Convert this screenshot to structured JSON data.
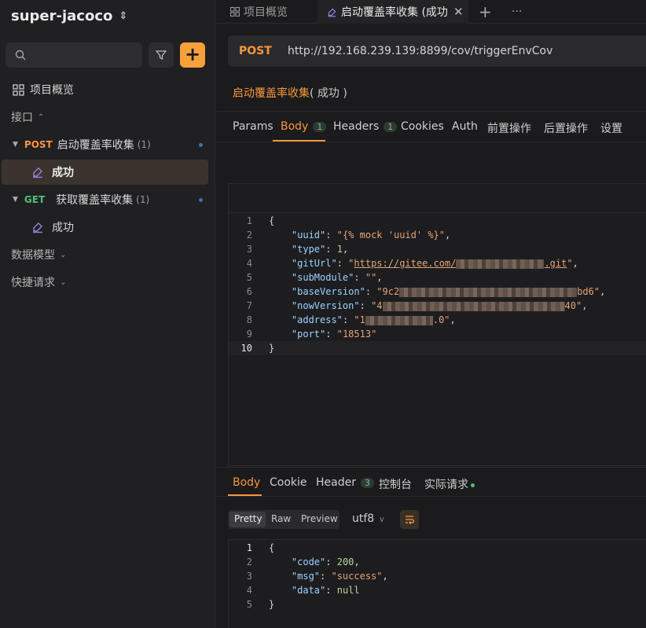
{
  "sidebar": {
    "project_name": "super-jacoco",
    "project_chevron": "⌃⌄",
    "search_placeholder": "",
    "overview_label": "项目概览",
    "interfaces_label": "接口",
    "items": [
      {
        "method": "POST",
        "name": "启动覆盖率收集",
        "count": "(1)",
        "case": "成功"
      },
      {
        "method": "GET",
        "name": "获取覆盖率收集",
        "count": "(1)",
        "case": "成功"
      }
    ],
    "data_models_label": "数据模型",
    "quick_requests_label": "快捷请求"
  },
  "tabs": {
    "overview": "项目概览",
    "active": "启动覆盖率收集 (成功",
    "add": "+",
    "more": "···"
  },
  "request": {
    "method": "POST",
    "url": "http://192.168.239.139:8899/cov/triggerEnvCov",
    "title": "启动覆盖率收集",
    "title_suffix": "( 成功 )",
    "tabs": [
      {
        "label": "Params"
      },
      {
        "label": "Body",
        "badge": "1"
      },
      {
        "label": "Headers",
        "badge": "1"
      },
      {
        "label": "Cookies"
      },
      {
        "label": "Auth"
      },
      {
        "label": "前置操作"
      },
      {
        "label": "后置操作"
      },
      {
        "label": "设置"
      }
    ],
    "body_lines": [
      "{",
      "    \"uuid\": \"{% mock 'uuid' %}\",",
      "    \"type\": 1,",
      "    \"gitUrl\": \"https://gitee.com/",
      "    \"subModule\": \"\",",
      "    \"baseVersion\": \"9c2",
      "    \"nowVersion\": \"4",
      "    \"address\": \"1",
      "    \"port\": \"18513\"",
      "}"
    ],
    "body_line_tails": {
      "gitUrl": ".git\",",
      "baseVersion": "bd6\",",
      "nowVersion": "40\",",
      "address": ".0\","
    }
  },
  "response": {
    "tabs": [
      {
        "label": "Body"
      },
      {
        "label": "Cookie"
      },
      {
        "label": "Header",
        "badge": "3"
      },
      {
        "label": "控制台"
      },
      {
        "label": "实际请求"
      }
    ],
    "formats": [
      "Pretty",
      "Raw",
      "Preview"
    ],
    "encoding": "utf8",
    "body_lines": [
      "{",
      "    \"code\": 200,",
      "    \"msg\": \"success\",",
      "    \"data\": null",
      "}"
    ]
  },
  "colors": {
    "accent": "#f6a03c",
    "post": "#f6963c",
    "get": "#4fbf7a"
  }
}
